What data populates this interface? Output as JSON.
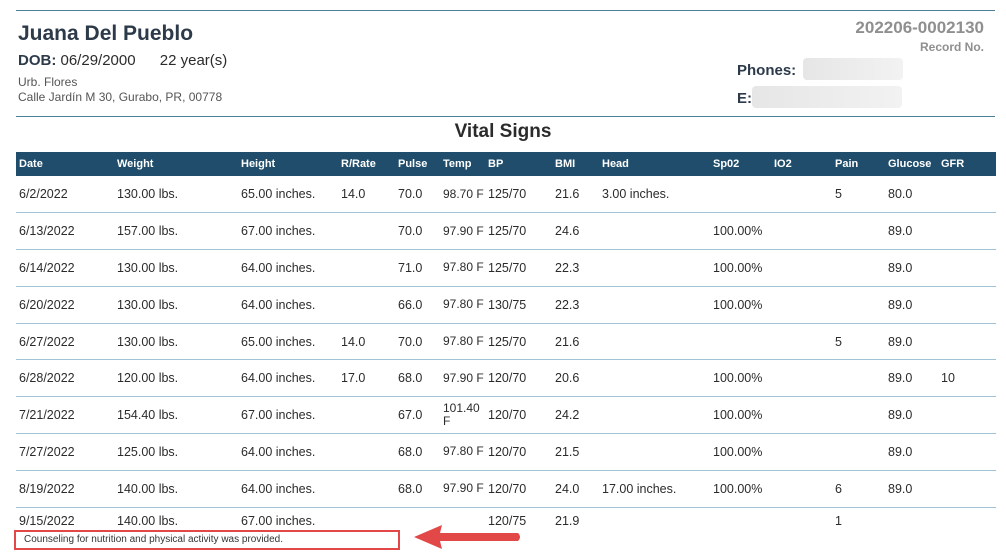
{
  "patient": {
    "name": "Juana Del Pueblo",
    "dob_label": "DOB:",
    "dob": "06/29/2000",
    "age": "22 year(s)",
    "address_line1": "Urb. Flores",
    "address_line2": "Calle Jardín M 30, Gurabo, PR, 00778"
  },
  "record": {
    "number": "202206-0002130",
    "label": "Record No."
  },
  "contact": {
    "phones_label": "Phones:",
    "email_label": "E:"
  },
  "section_title": "Vital Signs",
  "table": {
    "columns": [
      "Date",
      "Weight",
      "Height",
      "R/Rate",
      "Pulse",
      "Temp",
      "BP",
      "BMI",
      "Head",
      "Sp02",
      "IO2",
      "Pain",
      "Glucose",
      "GFR"
    ],
    "rows": [
      {
        "date": "6/2/2022",
        "weight": "130.00 lbs.",
        "height": "65.00 inches.",
        "rrate": "14.0",
        "pulse": "70.0",
        "temp": "98.70 F",
        "bp": "125/70",
        "bmi": "21.6",
        "head": "3.00 inches.",
        "spo2": "",
        "io2": "",
        "pain": "5",
        "glucose": "80.0",
        "gfr": ""
      },
      {
        "date": "6/13/2022",
        "weight": "157.00 lbs.",
        "height": "67.00 inches.",
        "rrate": "",
        "pulse": "70.0",
        "temp": "97.90 F",
        "bp": "125/70",
        "bmi": "24.6",
        "head": "",
        "spo2": "100.00%",
        "io2": "",
        "pain": "",
        "glucose": "89.0",
        "gfr": ""
      },
      {
        "date": "6/14/2022",
        "weight": "130.00 lbs.",
        "height": "64.00 inches.",
        "rrate": "",
        "pulse": "71.0",
        "temp": "97.80 F",
        "bp": "125/70",
        "bmi": "22.3",
        "head": "",
        "spo2": "100.00%",
        "io2": "",
        "pain": "",
        "glucose": "89.0",
        "gfr": ""
      },
      {
        "date": "6/20/2022",
        "weight": "130.00 lbs.",
        "height": "64.00 inches.",
        "rrate": "",
        "pulse": "66.0",
        "temp": "97.80 F",
        "bp": "130/75",
        "bmi": "22.3",
        "head": "",
        "spo2": "100.00%",
        "io2": "",
        "pain": "",
        "glucose": "89.0",
        "gfr": ""
      },
      {
        "date": "6/27/2022",
        "weight": "130.00 lbs.",
        "height": "65.00 inches.",
        "rrate": "14.0",
        "pulse": "70.0",
        "temp": "97.80 F",
        "bp": "125/70",
        "bmi": "21.6",
        "head": "",
        "spo2": "",
        "io2": "",
        "pain": "5",
        "glucose": "89.0",
        "gfr": ""
      },
      {
        "date": "6/28/2022",
        "weight": "120.00 lbs.",
        "height": "64.00 inches.",
        "rrate": "17.0",
        "pulse": "68.0",
        "temp": "97.90 F",
        "bp": "120/70",
        "bmi": "20.6",
        "head": "",
        "spo2": "100.00%",
        "io2": "",
        "pain": "",
        "glucose": "89.0",
        "gfr": "10"
      },
      {
        "date": "7/21/2022",
        "weight": "154.40 lbs.",
        "height": "67.00 inches.",
        "rrate": "",
        "pulse": "67.0",
        "temp": "101.40 F",
        "bp": "120/70",
        "bmi": "24.2",
        "head": "",
        "spo2": "100.00%",
        "io2": "",
        "pain": "",
        "glucose": "89.0",
        "gfr": ""
      },
      {
        "date": "7/27/2022",
        "weight": "125.00 lbs.",
        "height": "64.00 inches.",
        "rrate": "",
        "pulse": "68.0",
        "temp": "97.80 F",
        "bp": "120/70",
        "bmi": "21.5",
        "head": "",
        "spo2": "100.00%",
        "io2": "",
        "pain": "",
        "glucose": "89.0",
        "gfr": ""
      },
      {
        "date": "8/19/2022",
        "weight": "140.00 lbs.",
        "height": "64.00 inches.",
        "rrate": "",
        "pulse": "68.0",
        "temp": "97.90 F",
        "bp": "120/70",
        "bmi": "24.0",
        "head": "17.00 inches.",
        "spo2": "100.00%",
        "io2": "",
        "pain": "6",
        "glucose": "89.0",
        "gfr": ""
      },
      {
        "date": "9/15/2022",
        "weight": "140.00 lbs.",
        "height": "67.00 inches.",
        "rrate": "",
        "pulse": "",
        "temp": "",
        "bp": "120/75",
        "bmi": "21.9",
        "head": "",
        "spo2": "",
        "io2": "",
        "pain": "1",
        "glucose": "",
        "gfr": ""
      }
    ]
  },
  "note": "Counseling for nutrition and physical activity was provided.",
  "colors": {
    "header_bg": "#1f4d6b",
    "rule": "#4a7f9a",
    "row_border": "#9fc3d4",
    "highlight": "#e24848"
  }
}
